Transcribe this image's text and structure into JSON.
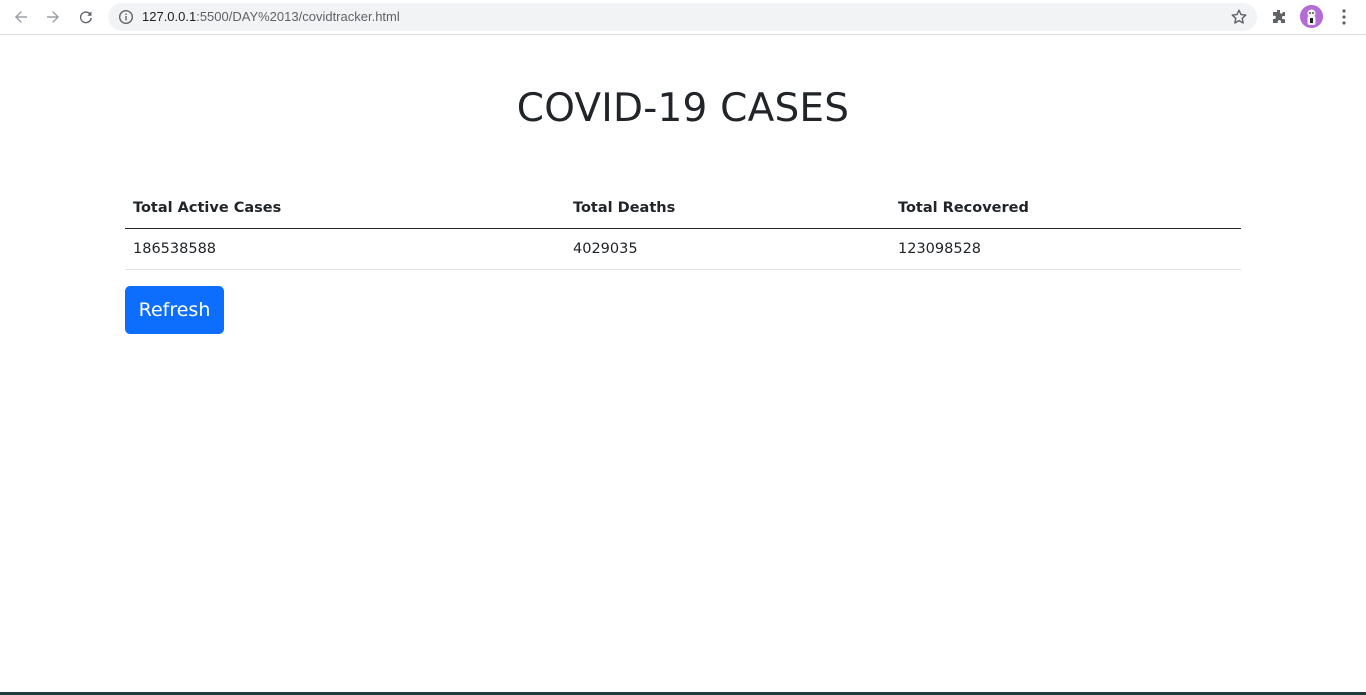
{
  "browser": {
    "url_host": "127.0.0.1",
    "url_path": ":5500/DAY%2013/covidtracker.html",
    "icons": [
      "back-arrow-icon",
      "forward-arrow-icon",
      "reload-icon",
      "info-icon",
      "star-icon",
      "extensions-icon",
      "kebab-menu-icon"
    ],
    "avatar_color": "#b36bd6"
  },
  "page": {
    "title": "COVID-19 CASES",
    "table": {
      "headers": [
        "Total Active Cases",
        "Total Deaths",
        "Total Recovered"
      ],
      "rows": [
        [
          "186538588",
          "4029035",
          "123098528"
        ]
      ]
    },
    "refresh_label": "Refresh",
    "accent_color": "#0d6efd"
  }
}
